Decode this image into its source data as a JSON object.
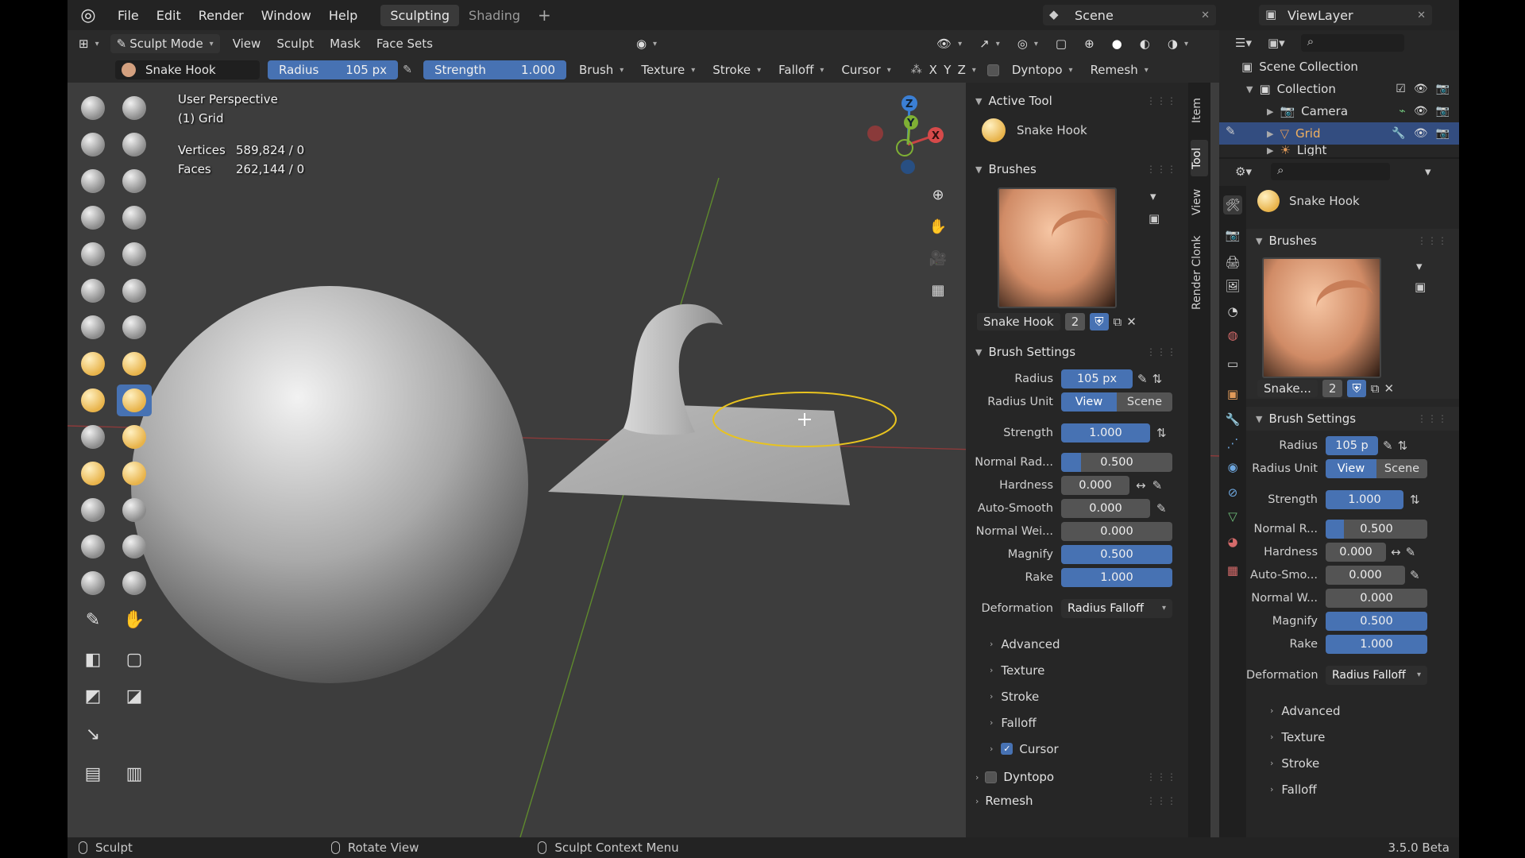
{
  "menubar": {
    "items": [
      "File",
      "Edit",
      "Render",
      "Window",
      "Help"
    ],
    "workspaces": [
      "Sculpting",
      "Shading"
    ],
    "active_workspace": "Sculpting",
    "scene": "Scene",
    "view_layer": "ViewLayer"
  },
  "viewport_header": {
    "mode": "Sculpt Mode",
    "menus": [
      "View",
      "Sculpt",
      "Mask",
      "Face Sets"
    ]
  },
  "tool_settings": {
    "brush_name": "Snake Hook",
    "radius_label": "Radius",
    "radius_value": "105 px",
    "strength_label": "Strength",
    "strength_value": "1.000",
    "menus": [
      "Brush",
      "Texture",
      "Stroke",
      "Falloff",
      "Cursor"
    ],
    "axes": [
      "X",
      "Y",
      "Z"
    ],
    "dyntopo": "Dyntopo",
    "remesh": "Remesh"
  },
  "viewport": {
    "perspective": "User Perspective",
    "object": "(1) Grid",
    "vertices_label": "Vertices",
    "vertices_value": "589,824 / 0",
    "faces_label": "Faces",
    "faces_value": "262,144 / 0",
    "gizmo_axes": [
      "Z",
      "Y",
      "X"
    ]
  },
  "npanel": {
    "tabs": [
      "Item",
      "Tool",
      "View",
      "Render Clonk"
    ],
    "active_tab": "Tool",
    "active_tool_header": "Active Tool",
    "active_tool": "Snake Hook",
    "brushes_header": "Brushes",
    "brush_name": "Snake Hook",
    "brush_users": "2",
    "brush_settings_header": "Brush Settings",
    "settings": {
      "radius_label": "Radius",
      "radius_value": "105 px",
      "radius_unit_label": "Radius Unit",
      "unit_view": "View",
      "unit_scene": "Scene",
      "strength_label": "Strength",
      "strength_value": "1.000",
      "normal_radius_label": "Normal Rad...",
      "normal_radius_value": "0.500",
      "hardness_label": "Hardness",
      "hardness_value": "0.000",
      "auto_smooth_label": "Auto-Smooth",
      "auto_smooth_value": "0.000",
      "normal_weight_label": "Normal Wei...",
      "normal_weight_value": "0.000",
      "magnify_label": "Magnify",
      "magnify_value": "0.500",
      "rake_label": "Rake",
      "rake_value": "1.000",
      "deformation_label": "Deformation",
      "deformation_value": "Radius Falloff"
    },
    "subpanels": [
      "Advanced",
      "Texture",
      "Stroke",
      "Falloff",
      "Cursor"
    ],
    "cursor_checked": true,
    "dyntopo": "Dyntopo",
    "remesh": "Remesh"
  },
  "outliner": {
    "root": "Scene Collection",
    "collection": "Collection",
    "items": [
      "Camera",
      "Grid",
      "Light"
    ],
    "selected": "Grid"
  },
  "properties": {
    "tool_name": "Snake Hook",
    "brushes_header": "Brushes",
    "brush_name": "Snake...",
    "brush_users": "2",
    "brush_settings_header": "Brush Settings",
    "settings": {
      "radius_label": "Radius",
      "radius_value": "105 p",
      "radius_unit_label": "Radius Unit",
      "unit_view": "View",
      "unit_scene": "Scene",
      "strength_label": "Strength",
      "strength_value": "1.000",
      "normal_radius_label": "Normal R...",
      "normal_radius_value": "0.500",
      "hardness_label": "Hardness",
      "hardness_value": "0.000",
      "auto_smooth_label": "Auto-Smo...",
      "auto_smooth_value": "0.000",
      "normal_weight_label": "Normal W...",
      "normal_weight_value": "0.000",
      "magnify_label": "Magnify",
      "magnify_value": "0.500",
      "rake_label": "Rake",
      "rake_value": "1.000",
      "deformation_label": "Deformation",
      "deformation_value": "Radius Falloff"
    },
    "subpanels": [
      "Advanced",
      "Texture",
      "Stroke",
      "Falloff"
    ]
  },
  "statusbar": {
    "left_action": "Sculpt",
    "middle_action": "Rotate View",
    "right_action": "Sculpt Context Menu",
    "version": "3.5.0 Beta"
  },
  "colors": {
    "accent": "#4772b3",
    "selection": "#334d80",
    "brush_cursor": "#e8c31f"
  }
}
